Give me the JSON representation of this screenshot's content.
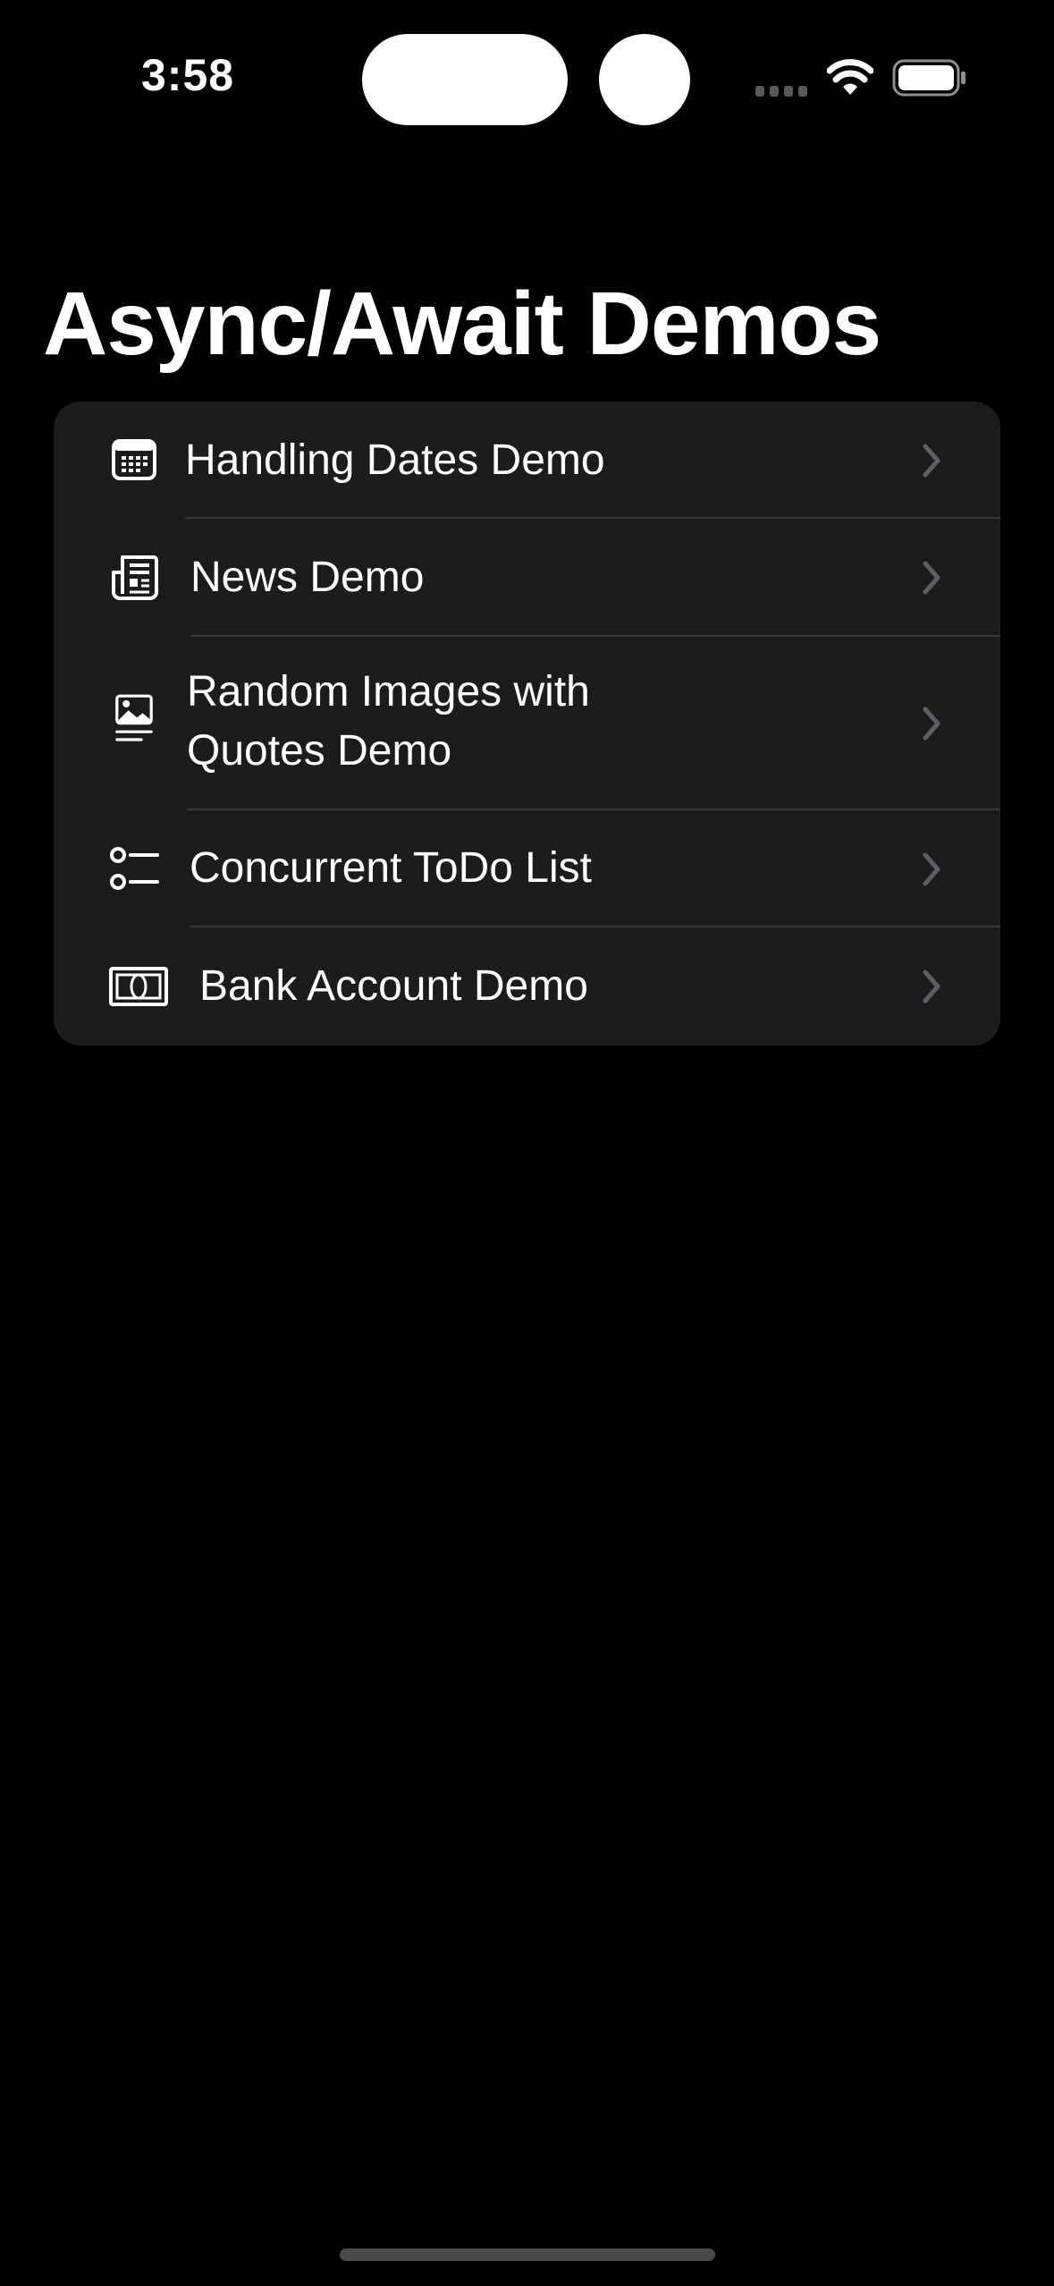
{
  "status_bar": {
    "time": "3:58"
  },
  "nav": {
    "title": "Async/Await Demos"
  },
  "list": {
    "items": [
      {
        "label": "Handling Dates Demo",
        "icon": "calendar-icon"
      },
      {
        "label": "News Demo",
        "icon": "newspaper-icon"
      },
      {
        "label_line1": "Random Images with",
        "label_line2": "Quotes Demo",
        "icon": "photo-text-icon"
      },
      {
        "label": "Concurrent ToDo List",
        "icon": "checklist-icon"
      },
      {
        "label": "Bank Account Demo",
        "icon": "banknote-icon"
      }
    ]
  },
  "colors": {
    "background": "#000000",
    "cell_background": "#1c1c1e",
    "separator": "#38383a",
    "chevron": "#5e5e63",
    "text": "#ffffff"
  }
}
